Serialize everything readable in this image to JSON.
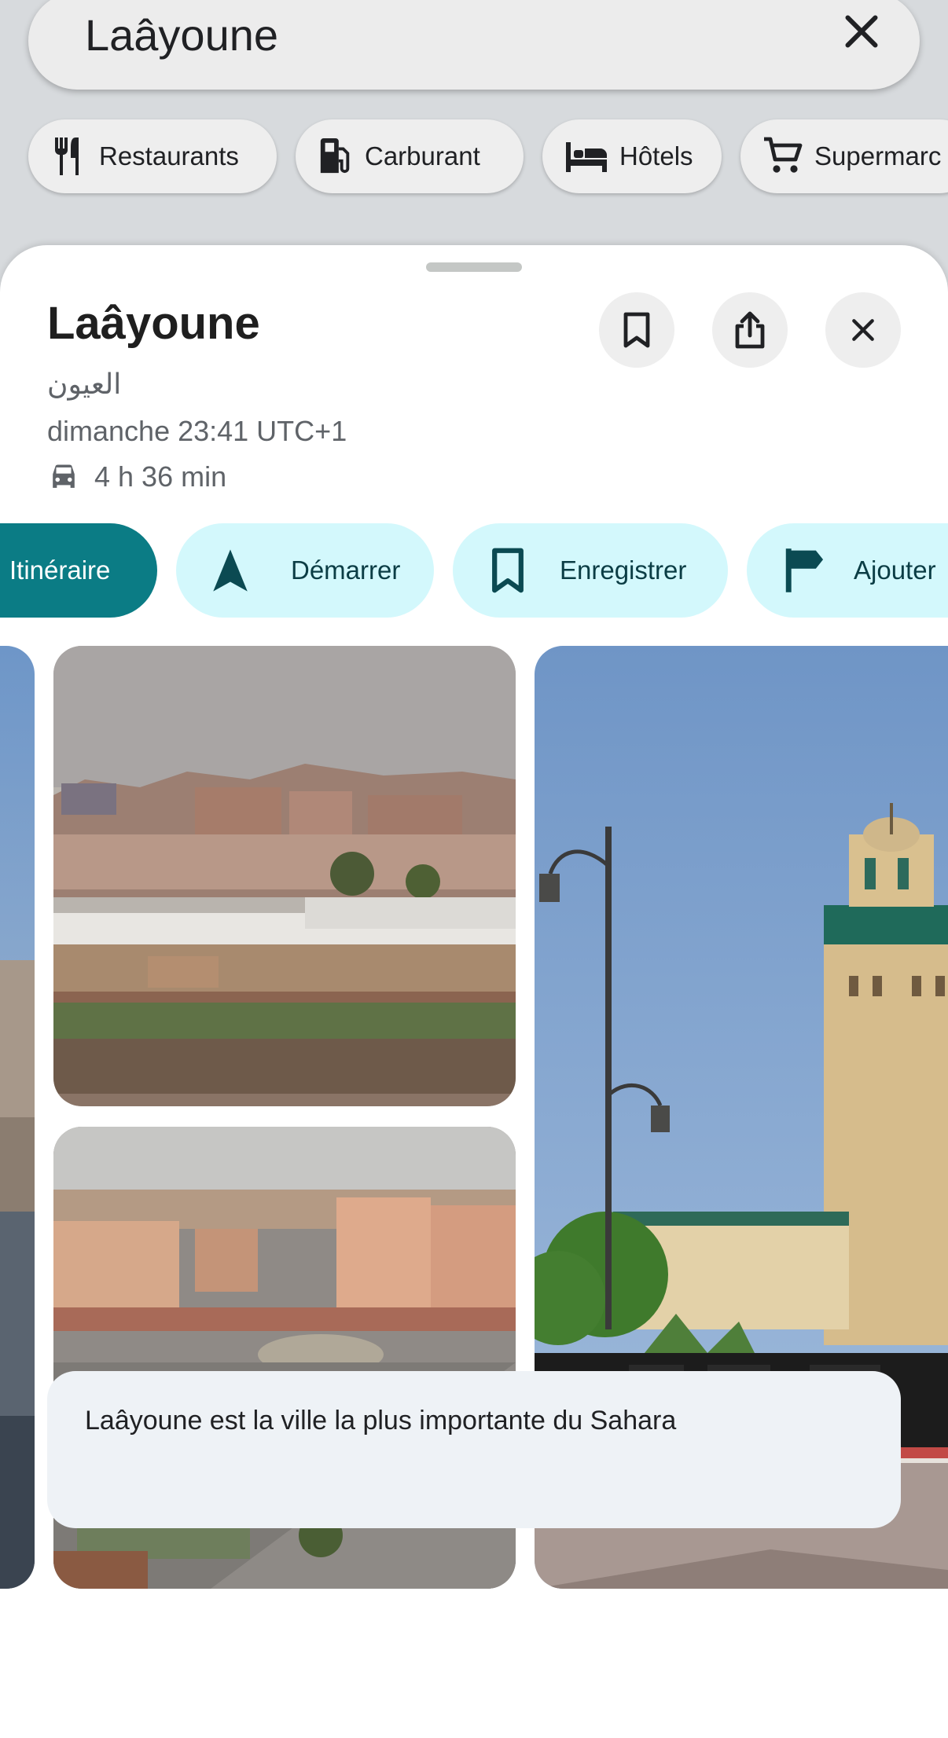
{
  "search": {
    "query": "Laâyoune"
  },
  "chips": [
    {
      "label": "Restaurants",
      "icon": "fork-knife-icon"
    },
    {
      "label": "Carburant",
      "icon": "gas-station-icon"
    },
    {
      "label": "Hôtels",
      "icon": "bed-icon"
    },
    {
      "label": "Supermarc",
      "icon": "cart-icon"
    }
  ],
  "place": {
    "name": "Laâyoune",
    "arabic_name": "العيون",
    "local_time": "dimanche 23:41 UTC+1",
    "drive_time": "4 h 36 min"
  },
  "actions": {
    "directions": "Itinéraire",
    "start": "Démarrer",
    "save": "Enregistrer",
    "add": "Ajouter"
  },
  "description": "Laâyoune est la ville la plus importante du Sahara",
  "colors": {
    "accent": "#0b7c85",
    "action_bg": "#d3f8fc",
    "action_text": "#0b3d45"
  }
}
